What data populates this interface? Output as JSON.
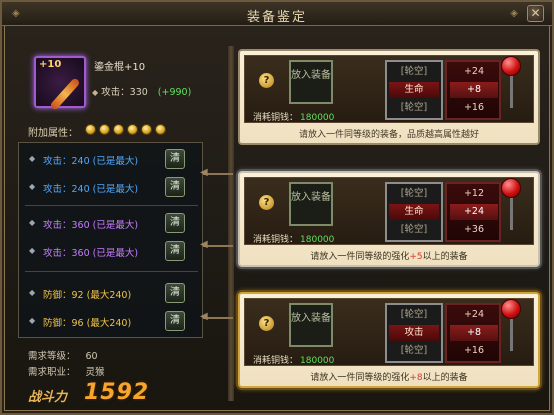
{
  "window": {
    "title": "装备鉴定",
    "close": "✕"
  },
  "item": {
    "plus": "+10",
    "name": "鎏金棍+10",
    "attack_label": "攻击：330",
    "attack_bonus": "(+990)"
  },
  "addon_label": "附加属性：",
  "gem_count": 6,
  "attributes": [
    {
      "text": "攻击：240 (已是最大)",
      "color": "blue",
      "button": "清"
    },
    {
      "text": "攻击：240 (已是最大)",
      "color": "blue",
      "button": "清"
    },
    {
      "text": "攻击：360 (已是最大)",
      "color": "purple",
      "button": "清"
    },
    {
      "text": "攻击：360 (已是最大)",
      "color": "purple",
      "button": "清"
    },
    {
      "text": "防御：92 (最大240)",
      "color": "gold",
      "button": "清"
    },
    {
      "text": "防御：96 (最大240)",
      "color": "gold",
      "button": "清"
    }
  ],
  "requirements": {
    "level_label": "需求等级：",
    "level": "60",
    "class_label": "需求职业：",
    "class": "灵猴"
  },
  "combat": {
    "label": "战斗力",
    "value": "1592"
  },
  "panels": [
    {
      "put_label": "放入装备",
      "cost_label": "消耗铜钱：",
      "cost": "180000",
      "rolls": [
        "[轮空]",
        "生命",
        "[轮空]"
      ],
      "values": [
        "+24",
        "+8",
        "+16"
      ],
      "hint": "请放入一件同等级的装备，品质越高属性越好",
      "hint_hl": ""
    },
    {
      "put_label": "放入装备",
      "cost_label": "消耗铜钱：",
      "cost": "180000",
      "rolls": [
        "[轮空]",
        "生命",
        "[轮空]"
      ],
      "values": [
        "+12",
        "+24",
        "+36"
      ],
      "hint_pre": "请放入一件同等级的强化",
      "hint_hl": "+5",
      "hint_post": "以上的装备"
    },
    {
      "put_label": "放入装备",
      "cost_label": "消耗铜钱：",
      "cost": "180000",
      "rolls": [
        "[轮空]",
        "攻击",
        "[轮空]"
      ],
      "values": [
        "+24",
        "+8",
        "+16"
      ],
      "hint_pre": "请放入一件同等级的强化",
      "hint_hl": "+8",
      "hint_post": "以上的装备"
    }
  ],
  "help_icon": "?"
}
